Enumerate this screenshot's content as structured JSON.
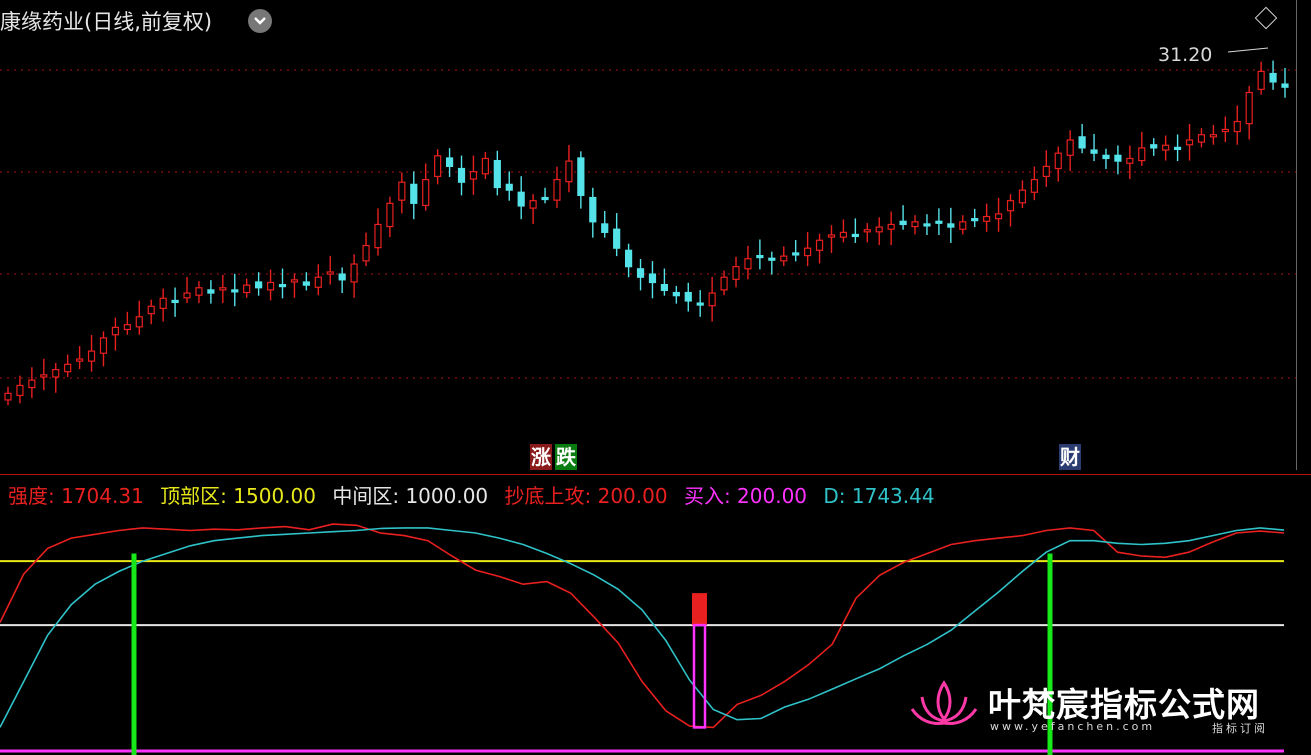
{
  "header": {
    "title": "康缘药业(日线,前复权)",
    "latest_price_label": "31.20"
  },
  "colors": {
    "up": "#e8201f",
    "down": "#54e3e9",
    "grid": "#b01010",
    "strength": "#e8201f",
    "d_line": "#2fc2c8",
    "top_zone": "#e8e81a",
    "mid_zone": "#e6e6e6",
    "buy": "#ff33ff",
    "signal_green": "#18e818"
  },
  "event_tags": {
    "rise": "涨",
    "fall": "跌",
    "finance": "财"
  },
  "indicator_legend": {
    "strength": "强度: 1704.31",
    "top_zone": "顶部区: 1500.00",
    "mid_zone": "中间区: 1000.00",
    "bottom_attack": "抄底上攻: 200.00",
    "buy": "买入: 200.00",
    "d": "D: 1743.44"
  },
  "watermark": {
    "name": "叶梵宸指标公式网",
    "url": "www.yefanchen.com",
    "sub": "指标订阅"
  },
  "chart_data": [
    {
      "type": "candlestick",
      "price_axis_labels": [
        "31.20"
      ],
      "closes_approx": [
        19.0,
        19.3,
        19.5,
        19.7,
        19.9,
        20.1,
        20.3,
        20.6,
        21.1,
        21.5,
        21.6,
        21.9,
        22.3,
        22.6,
        22.5,
        22.8,
        23.0,
        22.8,
        23.0,
        22.9,
        23.1,
        23.0,
        23.2,
        23.1,
        23.3,
        23.1,
        23.4,
        23.6,
        23.3,
        23.9,
        24.6,
        25.4,
        26.2,
        27.0,
        26.2,
        27.1,
        28.0,
        27.6,
        27.0,
        27.4,
        27.9,
        26.8,
        26.7,
        26.1,
        26.3,
        26.4,
        27.1,
        27.8,
        26.5,
        25.5,
        25.1,
        24.5,
        23.8,
        23.4,
        23.2,
        22.9,
        22.7,
        22.5,
        22.4,
        22.8,
        23.4,
        23.8,
        24.1,
        24.2,
        24.1,
        24.2,
        24.3,
        24.5,
        24.8,
        25.0,
        25.1,
        25.0,
        25.2,
        25.3,
        25.4,
        25.4,
        25.5,
        25.4,
        25.5,
        25.3,
        25.5,
        25.6,
        25.7,
        25.8,
        26.3,
        26.7,
        27.1,
        27.6,
        28.1,
        28.6,
        28.3,
        28.1,
        27.9,
        27.8,
        27.9,
        28.3,
        28.3,
        28.4,
        28.3,
        28.6,
        28.8,
        28.8,
        29.0,
        29.3,
        30.4,
        31.2,
        30.8,
        30.6
      ]
    },
    {
      "type": "line",
      "title": "",
      "series": [
        {
          "name": "强度",
          "values": [
            1020,
            1400,
            1600,
            1680,
            1710,
            1740,
            1760,
            1750,
            1740,
            1750,
            1745,
            1760,
            1770,
            1745,
            1790,
            1780,
            1720,
            1700,
            1660,
            1540,
            1430,
            1380,
            1320,
            1340,
            1250,
            1060,
            860,
            560,
            330,
            210,
            200,
            380,
            450,
            560,
            690,
            850,
            1210,
            1390,
            1490,
            1560,
            1630,
            1660,
            1680,
            1700,
            1740,
            1760,
            1740,
            1570,
            1540,
            1530,
            1570,
            1650,
            1720,
            1735,
            1720
          ]
        },
        {
          "name": "D",
          "values": [
            200,
            560,
            920,
            1160,
            1320,
            1420,
            1500,
            1560,
            1620,
            1660,
            1680,
            1700,
            1710,
            1720,
            1730,
            1740,
            1755,
            1760,
            1760,
            1740,
            1720,
            1680,
            1630,
            1560,
            1480,
            1390,
            1280,
            1120,
            880,
            570,
            340,
            260,
            270,
            360,
            420,
            500,
            580,
            660,
            760,
            850,
            960,
            1110,
            1260,
            1420,
            1570,
            1660,
            1660,
            1640,
            1630,
            1640,
            1660,
            1700,
            1740,
            1760,
            1743
          ]
        }
      ],
      "reference_levels": {
        "top_zone": 1500,
        "mid_zone": 1000,
        "bottom_attack": 200
      },
      "signals": {
        "bottom_attack_bar": [
          1000,
          1250
        ],
        "buy_bar": [
          200,
          1000
        ],
        "green_markers": 2
      }
    }
  ]
}
